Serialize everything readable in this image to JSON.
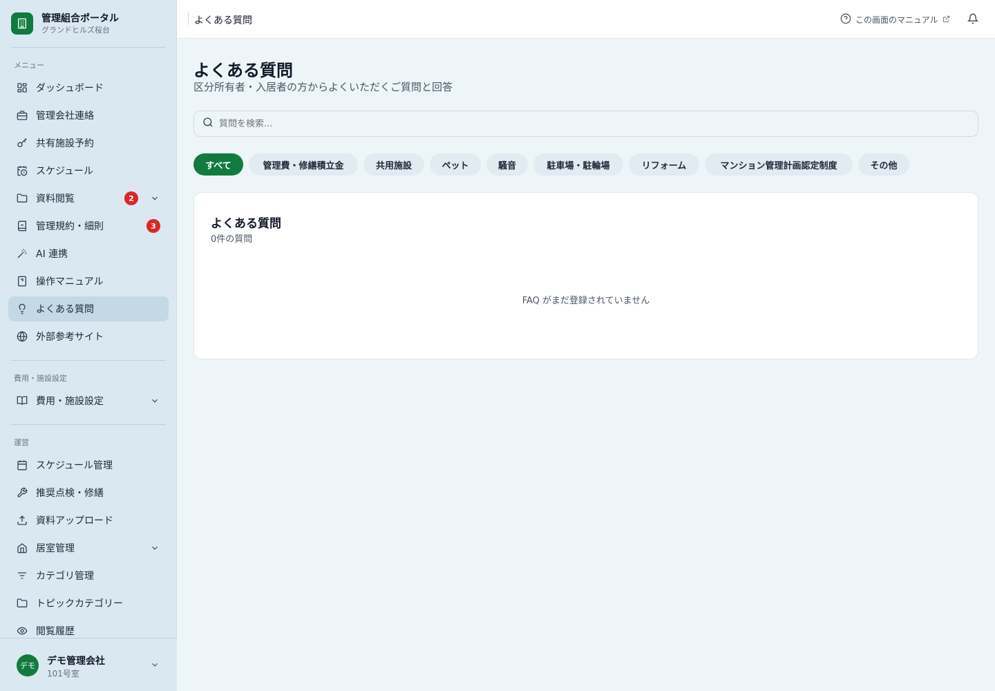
{
  "brand": {
    "title": "管理組合ポータル",
    "subtitle": "グランドヒルズ桜台"
  },
  "sections": {
    "menu": "メニュー",
    "cost": "費用・施設設定",
    "ops": "運営"
  },
  "menu": [
    {
      "label": "ダッシュボード",
      "icon": "dashboard-icon"
    },
    {
      "label": "管理会社連絡",
      "icon": "briefcase-icon"
    },
    {
      "label": "共有施設予約",
      "icon": "key-icon"
    },
    {
      "label": "スケジュール",
      "icon": "calendar-clock-icon"
    },
    {
      "label": "資料閲覧",
      "icon": "folder-icon",
      "badge": "2"
    },
    {
      "label": "管理規約・細則",
      "icon": "book-icon",
      "badge": "3"
    },
    {
      "label": "AI 連携",
      "icon": "sparkle-wand-icon"
    },
    {
      "label": "操作マニュアル",
      "icon": "manual-icon"
    },
    {
      "label": "よくある質問",
      "icon": "lightbulb-icon"
    },
    {
      "label": "外部参考サイト",
      "icon": "globe-icon"
    }
  ],
  "cost_menu": [
    {
      "label": "費用・施設設定",
      "icon": "open-book-icon"
    }
  ],
  "ops_menu": [
    {
      "label": "スケジュール管理",
      "icon": "calendar-icon"
    },
    {
      "label": "推奨点検・修繕",
      "icon": "wrench-icon"
    },
    {
      "label": "資料アップロード",
      "icon": "upload-icon"
    },
    {
      "label": "居室管理",
      "icon": "home-icon"
    },
    {
      "label": "カテゴリ管理",
      "icon": "filter-icon"
    },
    {
      "label": "トピックカテゴリー",
      "icon": "folder-icon"
    },
    {
      "label": "閲覧履歴",
      "icon": "eye-icon"
    }
  ],
  "user": {
    "avatar_text": "デモ",
    "name": "デモ管理会社",
    "room": "101号室"
  },
  "topbar": {
    "title": "よくある質問",
    "manual_link": "この画面のマニュアル"
  },
  "page": {
    "title": "よくある質問",
    "subtitle": "区分所有者・入居者の方からよくいただくご質問と回答"
  },
  "search": {
    "placeholder": "質問を検索...",
    "value": ""
  },
  "categories": [
    "すべて",
    "管理費・修繕積立金",
    "共用施設",
    "ペット",
    "騒音",
    "駐車場・駐輪場",
    "リフォーム",
    "マンション管理計画認定制度",
    "その他"
  ],
  "faq_card": {
    "title": "よくある質問",
    "count_text": "0件の質問",
    "empty_text": "FAQ がまだ登録されていません"
  },
  "colors": {
    "accent": "#127a3f",
    "badge": "#dc2626",
    "sidebar_bg": "#d9e8f1",
    "active_bg": "#c3d9e6"
  }
}
